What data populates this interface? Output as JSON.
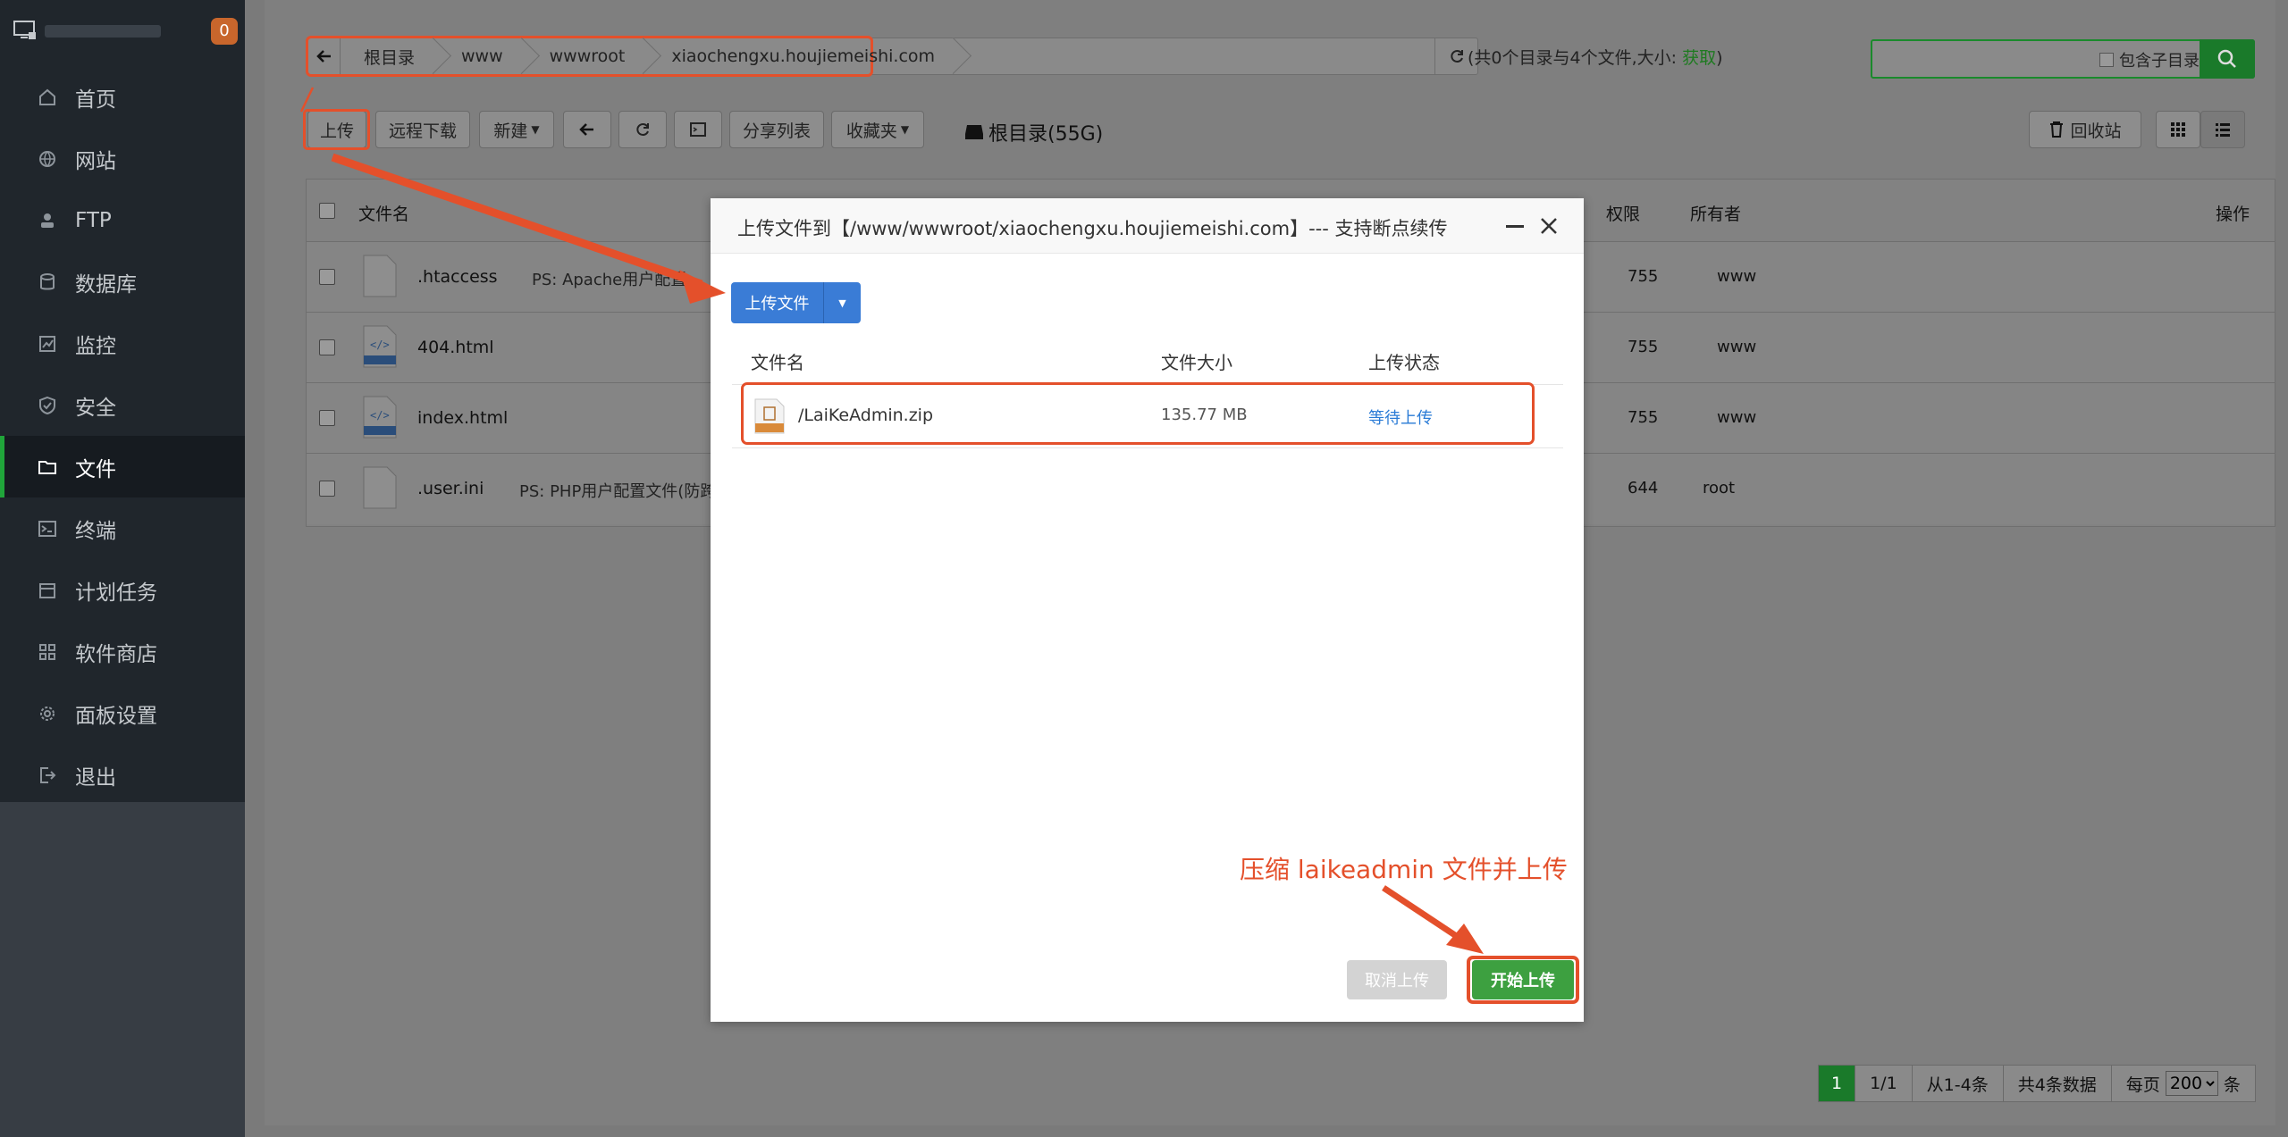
{
  "sidebar": {
    "badge": "0",
    "items": [
      {
        "label": "首页",
        "icon": "home-icon"
      },
      {
        "label": "网站",
        "icon": "globe-icon"
      },
      {
        "label": "FTP",
        "icon": "ftp-icon"
      },
      {
        "label": "数据库",
        "icon": "database-icon"
      },
      {
        "label": "监控",
        "icon": "monitor-chart-icon"
      },
      {
        "label": "安全",
        "icon": "shield-icon"
      },
      {
        "label": "文件",
        "icon": "folder-icon"
      },
      {
        "label": "终端",
        "icon": "terminal-icon"
      },
      {
        "label": "计划任务",
        "icon": "calendar-icon"
      },
      {
        "label": "软件商店",
        "icon": "apps-grid-icon"
      },
      {
        "label": "面板设置",
        "icon": "gear-icon"
      },
      {
        "label": "退出",
        "icon": "logout-icon"
      }
    ]
  },
  "path": {
    "crumbs": [
      "根目录",
      "www",
      "wwwroot",
      "xiaochengxu.houjiemeishi.com"
    ],
    "info_prefix": "(共0个目录与4个文件,大小: ",
    "info_fetch": "获取",
    "info_suffix": ")"
  },
  "search": {
    "include_sub_label": "包含子目录"
  },
  "toolbar": {
    "upload": "上传",
    "remote_download": "远程下载",
    "new": "新建",
    "share_list": "分享列表",
    "favorites": "收藏夹",
    "disk": "根目录(55G)",
    "recycle": "回收站"
  },
  "table": {
    "headers": {
      "name": "文件名",
      "perm": "权限",
      "owner": "所有者",
      "ops": "操作"
    },
    "rows": [
      {
        "name": ".htaccess",
        "note": "PS: Apache用户配置...",
        "perm": "755",
        "owner": "www"
      },
      {
        "name": "404.html",
        "note": "",
        "perm": "755",
        "owner": "www"
      },
      {
        "name": "index.html",
        "note": "",
        "perm": "755",
        "owner": "www"
      },
      {
        "name": ".user.ini",
        "note": "PS: PHP用户配置文件(防跨站",
        "perm": "644",
        "owner": "root"
      }
    ]
  },
  "pager": {
    "current": "1",
    "pages": "1/1",
    "range": "从1-4条",
    "total": "共4条数据",
    "per_page_label": "每页",
    "per_page_value": "200",
    "unit": "条"
  },
  "modal": {
    "title": "上传文件到【/www/wwwroot/xiaochengxu.houjiemeishi.com】--- 支持断点续传",
    "upload_files": "上传文件",
    "col_name": "文件名",
    "col_size": "文件大小",
    "col_status": "上传状态",
    "file": {
      "name": "/LaiKeAdmin.zip",
      "size": "135.77 MB",
      "status": "等待上传"
    },
    "annotation": "压缩 laikeadmin 文件并上传",
    "cancel": "取消上传",
    "start": "开始上传"
  },
  "colors": {
    "accent_green": "#20a53a",
    "annotation_red": "#e4502b",
    "primary_blue": "#3a7cd6"
  }
}
